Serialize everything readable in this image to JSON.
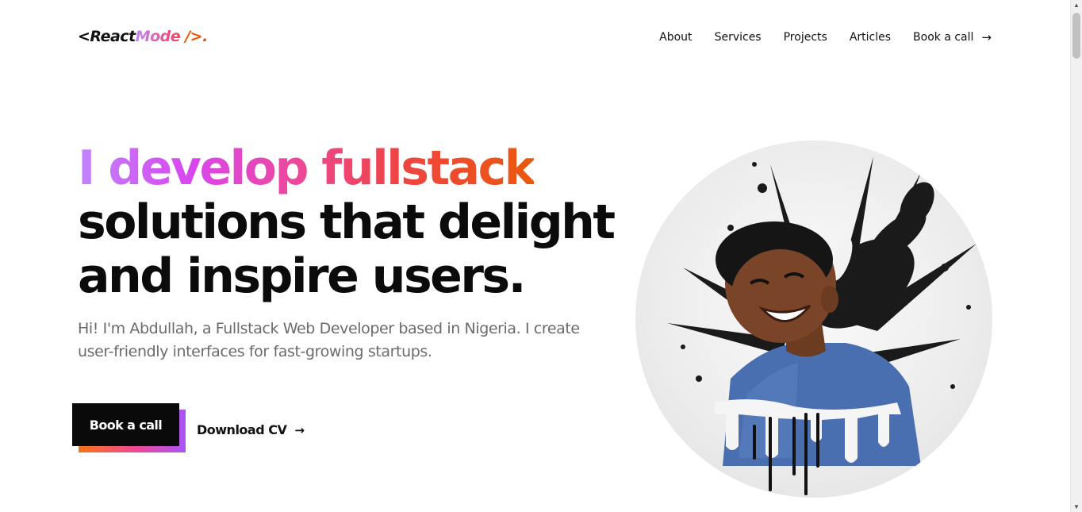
{
  "header": {
    "logo": {
      "open": "<React",
      "mode": "Mode",
      "close": " />",
      "dot": "."
    },
    "nav": [
      {
        "label": "About"
      },
      {
        "label": "Services"
      },
      {
        "label": "Projects"
      },
      {
        "label": "Articles"
      },
      {
        "label": "Book a call",
        "icon": "arrow-right-icon"
      }
    ]
  },
  "hero": {
    "headline_highlight": "I develop fullstack",
    "headline_line2": "solutions that delight",
    "headline_line3": "and inspire users.",
    "subtext": "Hi! I'm Abdullah, a Fullstack Web Developer based in Nigeria. I create user-friendly interfaces for fast-growing startups.",
    "cta_primary": "Book a call",
    "cta_secondary": "Download CV",
    "cta_secondary_icon": "arrow-right-icon",
    "portrait": "portrait-image"
  },
  "colors": {
    "gradient_start": "#c084fc",
    "gradient_mid": "#ec4899",
    "gradient_end": "#ea580c",
    "text_dark": "#0b0b0b",
    "text_muted": "#6b6b6b",
    "button_bg": "#0a0a0a"
  }
}
